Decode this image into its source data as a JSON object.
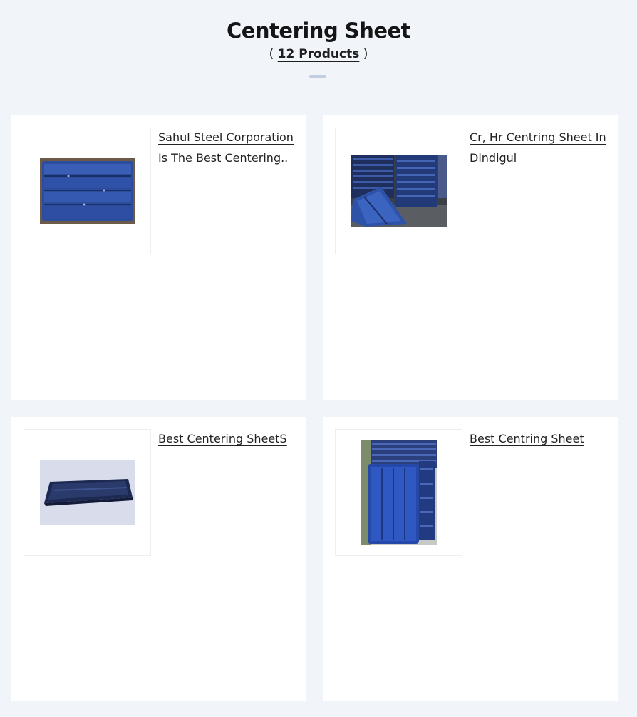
{
  "page": {
    "title": "Centering Sheet",
    "count_open": "( ",
    "count_link": "12 Products",
    "count_close": " )"
  },
  "products": [
    {
      "name": "Sahul Steel Corporation Is The Best Centering..",
      "image_icon": "blue-centering-sheet-panel-image"
    },
    {
      "name": "Cr, Hr Centring Sheet In Dindigul",
      "image_icon": "stacked-centring-sheets-image"
    },
    {
      "name": "Best Centering SheetS",
      "image_icon": "tray-centering-sheet-image"
    },
    {
      "name": "Best Centring Sheet",
      "image_icon": "upright-centring-sheet-image"
    }
  ],
  "colors": {
    "background": "#f1f4f9",
    "card": "#ffffff",
    "divider": "#c3cde4",
    "sheet_blue": "#2b4fa3"
  }
}
